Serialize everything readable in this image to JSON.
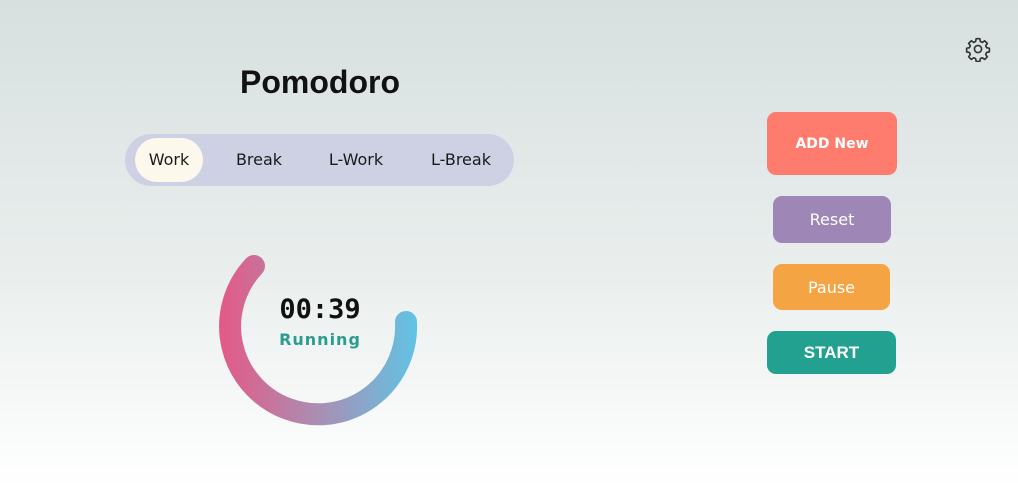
{
  "app": {
    "title": "Pomodoro"
  },
  "settings": {
    "icon": "gear-icon"
  },
  "tabs": [
    {
      "label": "Work",
      "active": true
    },
    {
      "label": "Break",
      "active": false
    },
    {
      "label": "L-Work",
      "active": false
    },
    {
      "label": "L-Break",
      "active": false
    }
  ],
  "timer": {
    "time": "00:39",
    "status": "Running",
    "ring_gradient": [
      "#e35a86",
      "#a98fb4",
      "#5ec5e6"
    ]
  },
  "buttons": {
    "add_new": "ADD New",
    "reset": "Reset",
    "pause": "Pause",
    "start": "START"
  },
  "colors": {
    "add_new": "#fd7c6e",
    "reset": "#9e86b7",
    "pause": "#f4a443",
    "start": "#23a190",
    "tab_bar": "#cdd1e3",
    "tab_active": "#fdf8ec",
    "status": "#2a9d8f"
  }
}
